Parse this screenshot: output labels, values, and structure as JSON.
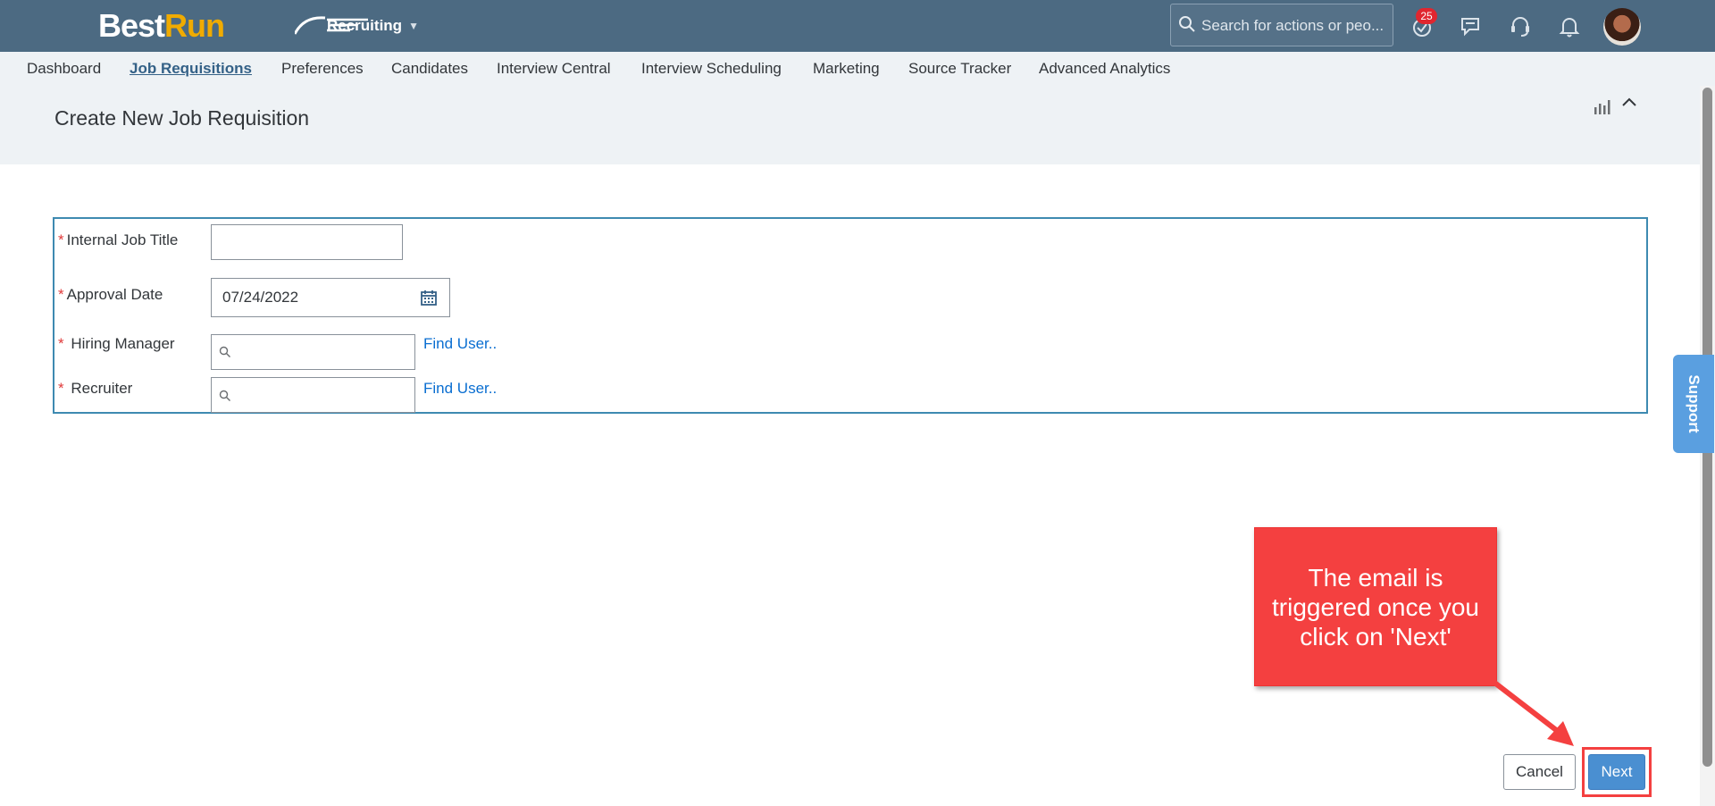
{
  "shell": {
    "logo_part1": "Best",
    "logo_part2": "Run",
    "module": "Recruiting",
    "search_placeholder": "Search for actions or peo...",
    "notification_count": "25"
  },
  "nav": {
    "items": [
      {
        "label": "Dashboard"
      },
      {
        "label": "Job Requisitions",
        "active": true
      },
      {
        "label": "Preferences"
      },
      {
        "label": "Candidates"
      },
      {
        "label": "Interview Central"
      },
      {
        "label": "Interview Scheduling"
      },
      {
        "label": "Marketing"
      },
      {
        "label": "Source Tracker"
      },
      {
        "label": "Advanced Analytics"
      }
    ]
  },
  "page": {
    "title": "Create New Job Requisition"
  },
  "form": {
    "required_marker": "*",
    "internal_job_title": {
      "label": "Internal Job Title",
      "value": ""
    },
    "approval_date": {
      "label": "Approval Date",
      "value": "07/24/2022"
    },
    "hiring_manager": {
      "label": "Hiring Manager",
      "value": "",
      "link": "Find User.."
    },
    "recruiter": {
      "label": "Recruiter",
      "value": "",
      "link": "Find User.."
    }
  },
  "support": {
    "label": "Support"
  },
  "callout": {
    "text": "The email is triggered once you click on 'Next'"
  },
  "actions": {
    "cancel": "Cancel",
    "next": "Next"
  },
  "colors": {
    "shell_bg": "#4c6a82",
    "nav_bg": "#eef2f5",
    "accent_link": "#0a6ed1",
    "primary_button": "#4a8fd1",
    "callout_red": "#f44040",
    "badge_red": "#e0262f",
    "logo_gold": "#f0ab00"
  }
}
